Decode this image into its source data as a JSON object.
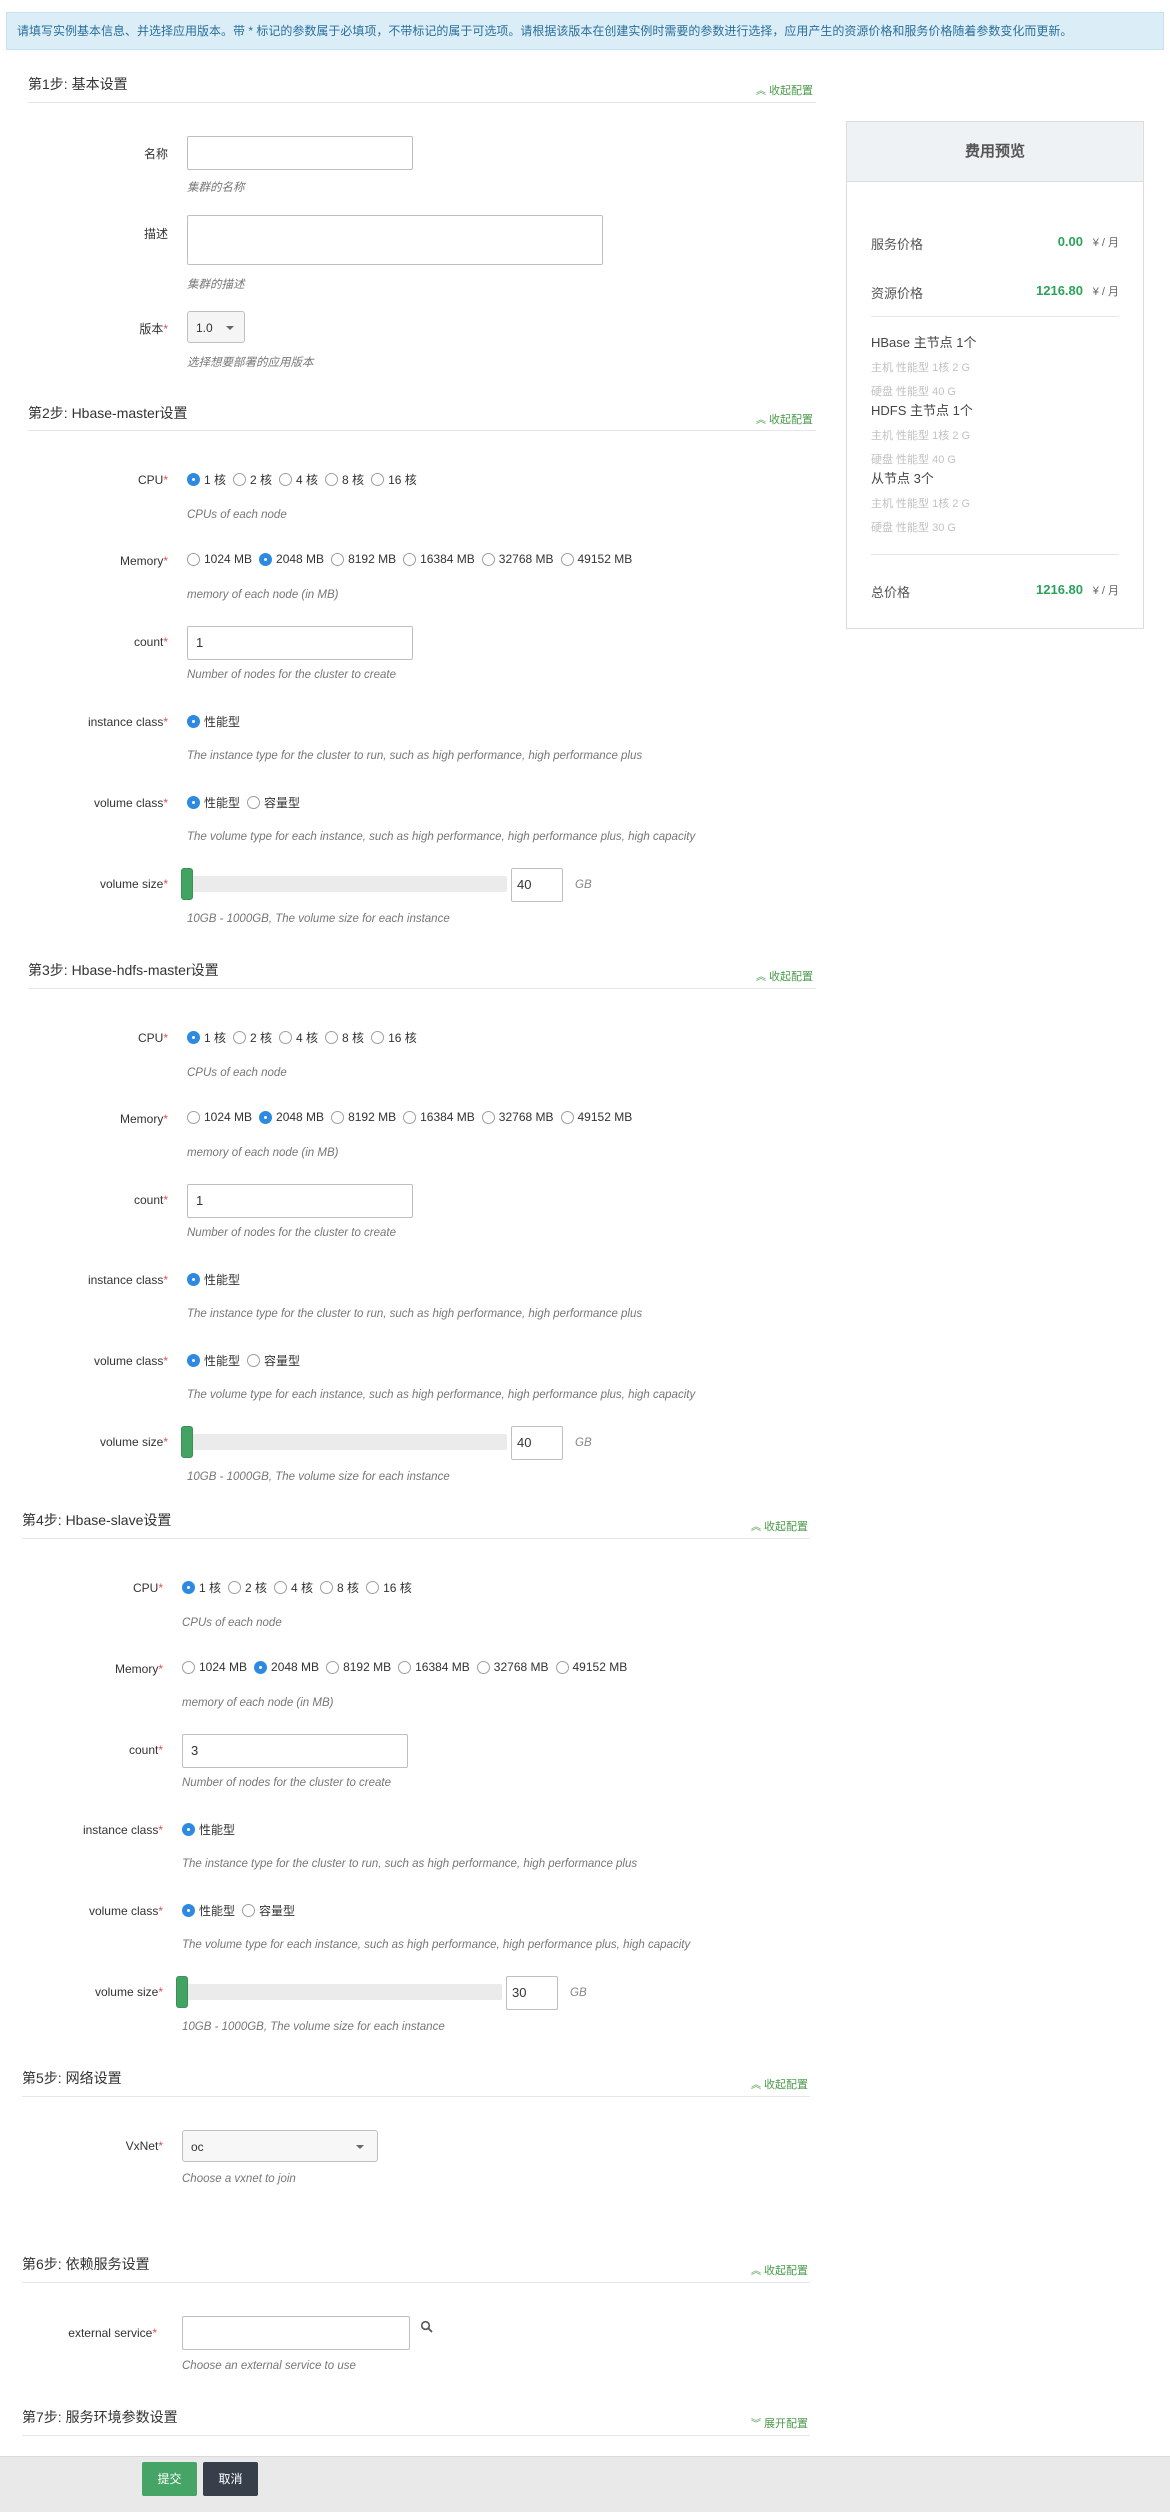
{
  "notice": "请填写实例基本信息、并选择应用版本。带 * 标记的参数属于必填项，不带标记的属于可选项。请根据该版本在创建实例时需要的参数进行选择，应用产生的资源价格和服务价格随着参数变化而更新。",
  "collapse_label": "收起配置",
  "expand_label": "展开配置",
  "required_mark": "*",
  "step1": {
    "title": "第1步: 基本设置",
    "name_label": "名称",
    "name_help": "集群的名称",
    "desc_label": "描述",
    "desc_help": "集群的描述",
    "version_label": "版本",
    "version_value": "1.0",
    "version_help": "选择想要部署的应用版本"
  },
  "cpu_options": [
    "1 核",
    "2 核",
    "4 核",
    "8 核",
    "16 核"
  ],
  "memory_options": [
    "1024 MB",
    "2048 MB",
    "8192 MB",
    "16384 MB",
    "32768 MB",
    "49152 MB"
  ],
  "labels": {
    "cpu": "CPU",
    "memory": "Memory",
    "count": "count",
    "instance_class": "instance class",
    "volume_class": "volume class",
    "volume_size": "volume size"
  },
  "helps": {
    "cpu": "CPUs of each node",
    "memory": "memory of each node (in MB)",
    "count": "Number of nodes for the cluster to create",
    "instance_class": "The instance type for the cluster to run, such as high performance, high performance plus",
    "volume_class": "The volume type for each instance, such as high performance, high performance plus, high capacity",
    "volume_size": "10GB - 1000GB, The volume size for each instance"
  },
  "instance_option": "性能型",
  "volume_options": [
    "性能型",
    "容量型"
  ],
  "gb_unit": "GB",
  "step2": {
    "title": "第2步: Hbase-master设置",
    "count": "1",
    "volume_size": "40",
    "volume_fraction": 0.0
  },
  "step3": {
    "title": "第3步: Hbase-hdfs-master设置",
    "count": "1",
    "volume_size": "40",
    "volume_fraction": 0.0
  },
  "step4": {
    "title": "第4步: Hbase-slave设置",
    "count": "3",
    "volume_size": "30",
    "volume_fraction": 0.0
  },
  "step5": {
    "title": "第5步: 网络设置",
    "vxnet_label": "VxNet",
    "vxnet_value": "oc",
    "vxnet_help": "Choose a vxnet to join"
  },
  "step6": {
    "title": "第6步: 依赖服务设置",
    "ext_label": "external service",
    "ext_help": "Choose an external service to use"
  },
  "step7": {
    "title": "第7步: 服务环境参数设置"
  },
  "cost": {
    "title": "费用预览",
    "service_label": "服务价格",
    "service_value": "0.00",
    "resource_label": "资源价格",
    "resource_value": "1216.80",
    "unit": "¥ / 月",
    "nodes": [
      {
        "title": "HBase 主节点 1个",
        "specs": [
          "主机 性能型 1核 2 G",
          "硬盘 性能型 40 G"
        ]
      },
      {
        "title": "HDFS 主节点 1个",
        "specs": [
          "主机 性能型 1核 2 G",
          "硬盘 性能型 40 G"
        ]
      },
      {
        "title": "从节点 3个",
        "specs": [
          "主机 性能型 1核 2 G",
          "硬盘 性能型 30 G"
        ]
      }
    ],
    "total_label": "总价格",
    "total_value": "1216.80"
  },
  "buttons": {
    "submit": "提交",
    "cancel": "取消"
  }
}
